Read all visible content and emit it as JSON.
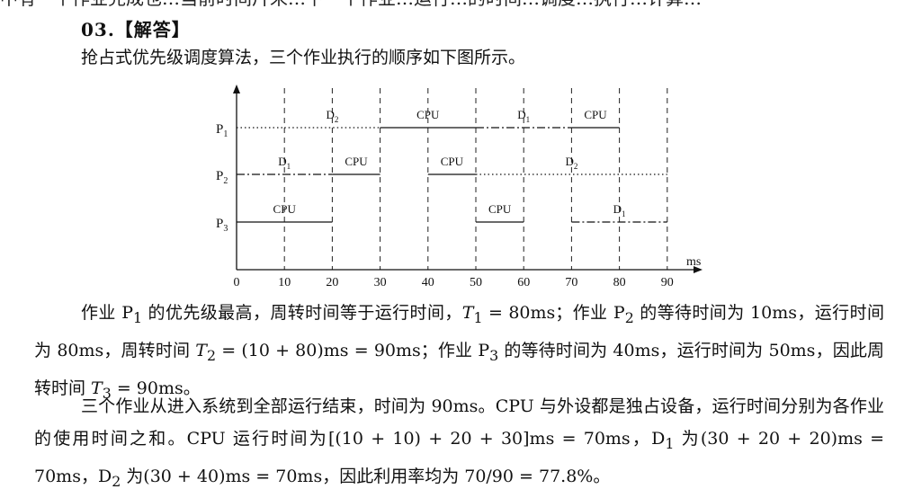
{
  "top_crop_text": "中有一个作业完成也…当前时间片未…下一个作业…运行…的时间…调度…执行…计算…",
  "heading": "03.【解答】",
  "intro": "抢占式优先级调度算法，三个作业执行的顺序如下图所示。",
  "chart_data": {
    "type": "gantt",
    "x_unit": "ms",
    "x_ticks": [
      "0",
      "10",
      "20",
      "30",
      "40",
      "50",
      "60",
      "70",
      "80",
      "90"
    ],
    "rows": [
      {
        "label": "P",
        "sub": "1",
        "y": 0,
        "segments": [
          {
            "start": 0,
            "end": 10,
            "style": "dotted",
            "label": ""
          },
          {
            "start": 10,
            "end": 30,
            "style": "dotted",
            "label": "D",
            "label_sub": "2"
          },
          {
            "start": 30,
            "end": 50,
            "style": "solid",
            "label": "CPU"
          },
          {
            "start": 50,
            "end": 70,
            "style": "dashdot",
            "label": "D",
            "label_sub": "1"
          },
          {
            "start": 70,
            "end": 80,
            "style": "solid",
            "label": "CPU"
          }
        ]
      },
      {
        "label": "P",
        "sub": "2",
        "y": 1,
        "segments": [
          {
            "start": 0,
            "end": 20,
            "style": "dashdot",
            "label": "D",
            "label_sub": "1"
          },
          {
            "start": 20,
            "end": 30,
            "style": "solid",
            "label": "CPU"
          },
          {
            "start": 40,
            "end": 50,
            "style": "solid",
            "label": "CPU"
          },
          {
            "start": 50,
            "end": 90,
            "style": "dotted",
            "label": "D",
            "label_sub": "2"
          }
        ]
      },
      {
        "label": "P",
        "sub": "3",
        "y": 2,
        "segments": [
          {
            "start": 0,
            "end": 20,
            "style": "solid",
            "label": "CPU"
          },
          {
            "start": 50,
            "end": 60,
            "style": "solid",
            "label": "CPU"
          },
          {
            "start": 70,
            "end": 90,
            "style": "dashdot",
            "label": "D",
            "label_sub": "1"
          }
        ]
      }
    ]
  },
  "para1": {
    "t1": "作业 P",
    "t1s": "1",
    "t2": " 的优先级最高，周转时间等于运行时间，",
    "t3": "T",
    "t3s": "1",
    "t4": " = 80ms；作业 P",
    "t4s": "2",
    "t5": " 的等待时间为 10ms，运行时间为 80ms，周转时间 ",
    "t6": "T",
    "t6s": "2",
    "t7": " = (10 + 80)ms = 90ms；作业 P",
    "t7s": "3",
    "t8": " 的等待时间为 40ms，运行时间为 50ms，因此周转时间 ",
    "t9": "T",
    "t9s": "3",
    "t10": " = 90ms。"
  },
  "para2": {
    "t1": "三个作业从进入系统到全部运行结束，时间为 90ms。CPU 与外设都是独占设备，运行时间分别为各作业的使用时间之和。CPU 运行时间为[(10 + 10) + 20 + 30]ms = 70ms，D",
    "t1s": "1",
    "t2": " 为(30 + 20 + 20)ms = 70ms，D",
    "t2s": "2",
    "t3": " 为(30 + 40)ms = 70ms，因此利用率均为 70/90 = 77.8%。"
  }
}
